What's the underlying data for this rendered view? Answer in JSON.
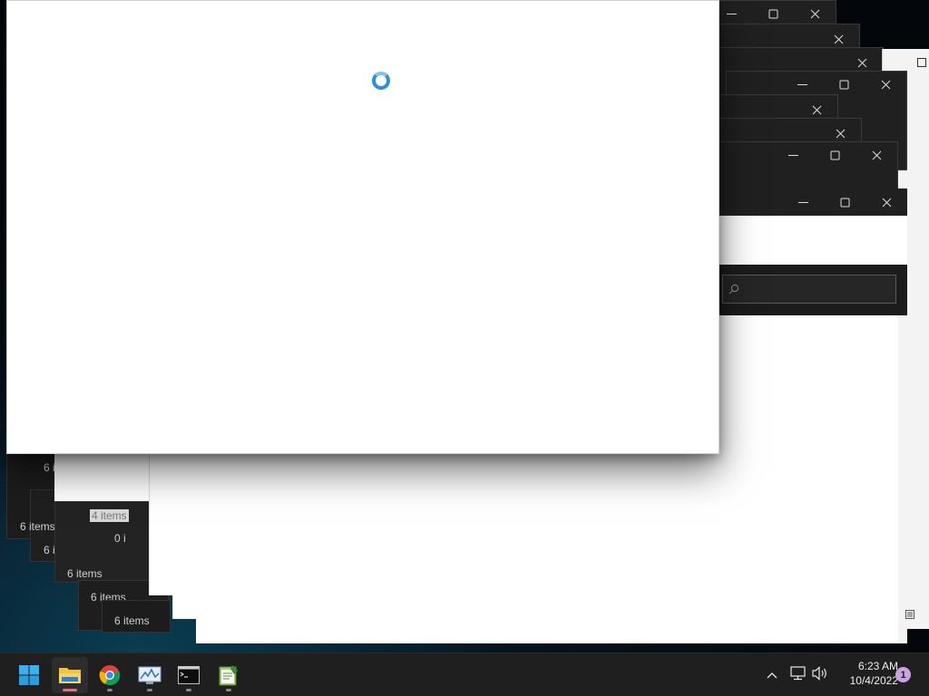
{
  "desktop": {
    "background_color": "#06121c"
  },
  "stacked_windows": {
    "item_count_labels": [
      "6 items",
      "6 items",
      "6 items",
      "6 items",
      "6 items",
      "6 items"
    ],
    "zero_items_label": "0 i",
    "faded_items_label": "4 items"
  },
  "caption_buttons": {
    "minimize_icon": "minimize-icon",
    "maximize_icon": "maximize-icon",
    "close_icon": "close-icon"
  },
  "search": {
    "icon": "search-icon"
  },
  "front_window": {
    "state": "loading",
    "spinner_color": "#2a8fe0"
  },
  "taskbar": {
    "apps": [
      {
        "name": "Start",
        "icon": "windows-start-icon",
        "running": false
      },
      {
        "name": "File Explorer",
        "icon": "file-explorer-icon",
        "running": true,
        "active": true
      },
      {
        "name": "Google Chrome",
        "icon": "chrome-icon",
        "running": true
      },
      {
        "name": "Performance Monitor",
        "icon": "performance-monitor-icon",
        "running": true
      },
      {
        "name": "Command Prompt",
        "icon": "command-prompt-icon",
        "running": true
      },
      {
        "name": "Notepad",
        "icon": "notepad-icon",
        "running": true
      }
    ],
    "tray": {
      "chevron_icon": "chevron-up-icon",
      "network_icon": "network-icon",
      "volume_icon": "volume-icon"
    },
    "clock": {
      "time": "6:23 AM",
      "date": "10/4/2022"
    },
    "notification_count": "1",
    "accent_color": "#e0707a"
  }
}
